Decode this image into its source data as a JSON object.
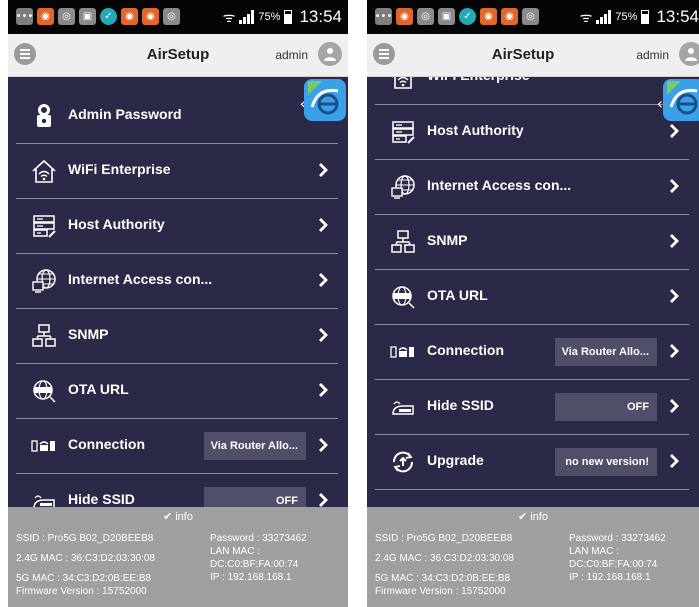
{
  "status_bar": {
    "icons": [
      "chat-app-icon",
      "photos-app-icon",
      "camera-app-icon",
      "gallery-app-icon",
      "check-app-icon",
      "app-icon",
      "app-icon",
      "camera-app-icon"
    ],
    "battery": "75%",
    "time": "13:54"
  },
  "app_bar": {
    "title": "AirSetup",
    "user": "admin"
  },
  "settings": {
    "admin_password": "Admin Password",
    "wifi_enterprise": "WiFi Enterprise",
    "host_authority": "Host Authority",
    "internet_access": "Internet Access con...",
    "snmp": "SNMP",
    "ota_url": "OTA URL",
    "connection": "Connection",
    "connection_value": "Via Router Allo...",
    "hide_ssid": "Hide SSID",
    "hide_ssid_value": "OFF",
    "upgrade": "Upgrade",
    "upgrade_value": "no new version!"
  },
  "info": {
    "toggle_label": "info",
    "ssid": "SSID : Pro5G B02_D20BEEB8",
    "password": "Password : 33273462",
    "mac_24g": "2.4G MAC : 36:C3:D2:03:30:08",
    "lan_mac_label": "LAN MAC :",
    "lan_mac_value": "DC:C0:BF:FA:00:74",
    "mac_5g": "5G MAC : 34:C3:D2:0B:EE:B8",
    "ip": "IP : 192.168.168.1",
    "firmware": "Firmware Version : 15752000"
  },
  "colors": {
    "background": "#2a2a48",
    "divider": "#8b8bb0",
    "value_box": "#4f4f6a",
    "info_panel": "#9f9f9f",
    "app_bar": "#efefef",
    "badge": "#3aa0e8"
  }
}
